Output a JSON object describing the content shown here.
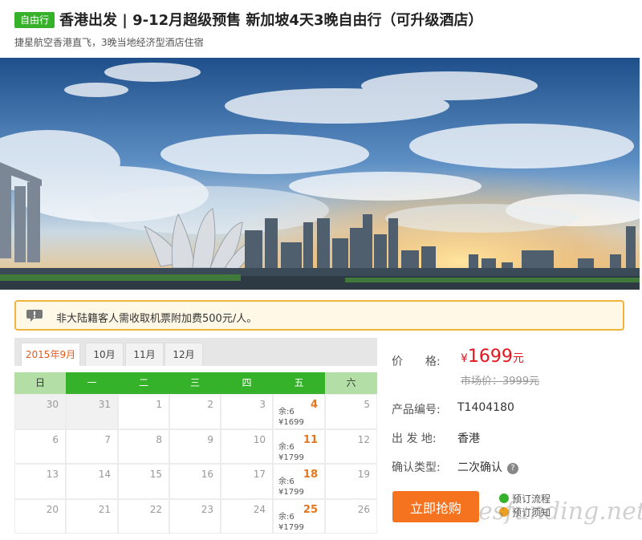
{
  "header": {
    "badge": "自由行",
    "title": "香港出发 | 9-12月超级预售 新加坡4天3晚自由行（可升级酒店）",
    "subtitle": "捷星航空香港直飞，3晚当地经济型酒店住宿"
  },
  "banner": {
    "alt": "Singapore skyline at sunset"
  },
  "notice": {
    "text": "非大陆籍客人需收取机票附加费500元/人。",
    "icon": "exclamation-icon"
  },
  "calendar": {
    "tabs": [
      "2015年9月",
      "10月",
      "11月",
      "12月"
    ],
    "active_tab": 0,
    "weekdays": [
      "日",
      "一",
      "二",
      "三",
      "四",
      "五",
      "六"
    ],
    "rows": [
      [
        {
          "d": "30",
          "past": true
        },
        {
          "d": "31",
          "past": true
        },
        {
          "d": "1"
        },
        {
          "d": "2"
        },
        {
          "d": "3"
        },
        {
          "d": "4",
          "stock": "余:6",
          "price": "¥1699"
        },
        {
          "d": "5"
        }
      ],
      [
        {
          "d": "6"
        },
        {
          "d": "7"
        },
        {
          "d": "8"
        },
        {
          "d": "9"
        },
        {
          "d": "10"
        },
        {
          "d": "11",
          "stock": "余:6",
          "price": "¥1799"
        },
        {
          "d": "12"
        }
      ],
      [
        {
          "d": "13"
        },
        {
          "d": "14"
        },
        {
          "d": "15"
        },
        {
          "d": "16"
        },
        {
          "d": "17"
        },
        {
          "d": "18",
          "stock": "余:6",
          "price": "¥1799"
        },
        {
          "d": "19"
        }
      ],
      [
        {
          "d": "20"
        },
        {
          "d": "21"
        },
        {
          "d": "22"
        },
        {
          "d": "23"
        },
        {
          "d": "24"
        },
        {
          "d": "25",
          "stock": "余:6",
          "price": "¥1799"
        },
        {
          "d": "26"
        }
      ]
    ]
  },
  "info": {
    "price_label": "价　　格:",
    "price_currency": "¥",
    "price_value": "1699",
    "price_unit": "元",
    "market_price": "市场价：3999元",
    "product_no_label": "产品编号:",
    "product_no": "T1404180",
    "departure_label": "出 发 地:",
    "departure": "香港",
    "confirm_label": "确认类型:",
    "confirm_type": "二次确认",
    "help_icon": "?"
  },
  "actions": {
    "buy_label": "立即抢购",
    "link_process": "预订流程",
    "link_notice": "预订须知"
  },
  "watermark": "esfunding.net",
  "colors": {
    "accent_green": "#35b12a",
    "price_red": "#e5161f",
    "button_orange": "#f5731f",
    "sale_orange": "#e5761d"
  }
}
